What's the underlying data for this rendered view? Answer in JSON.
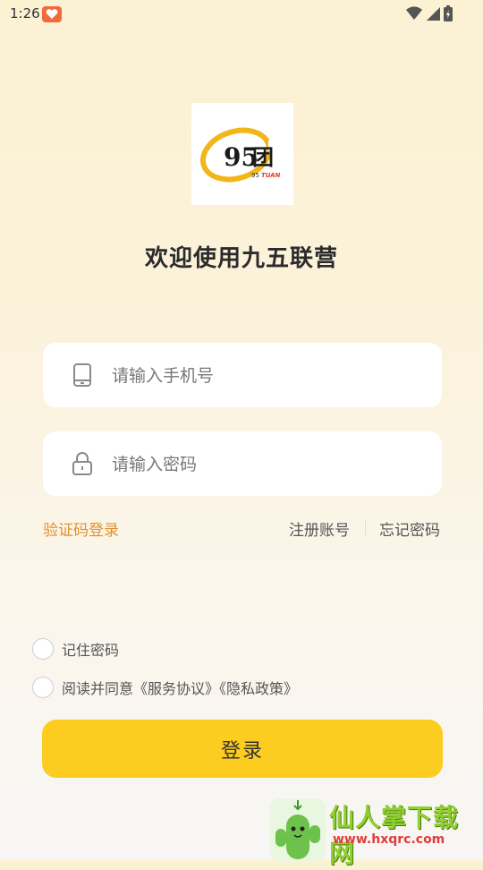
{
  "status_bar": {
    "time": "1:26"
  },
  "logo": {
    "number": "95",
    "char": "团",
    "sub_num": "95",
    "sub_text": "TUAN"
  },
  "welcome_title": "欢迎使用九五联营",
  "phone_field": {
    "placeholder": "请输入手机号",
    "value": ""
  },
  "password_field": {
    "placeholder": "请输入密码",
    "value": ""
  },
  "links": {
    "code_login": "验证码登录",
    "register": "注册账号",
    "forgot": "忘记密码"
  },
  "remember_password": {
    "label": "记住密码",
    "checked": false
  },
  "agreement": {
    "label": "阅读并同意《服务协议》《隐私政策》",
    "checked": false
  },
  "login_button": "登录",
  "watermark": {
    "title": "仙人掌下载网",
    "url": "www.hxqrc.com"
  },
  "colors": {
    "accent": "#fccd20",
    "link": "#e0902b",
    "logo_ring": "#f2b619"
  }
}
